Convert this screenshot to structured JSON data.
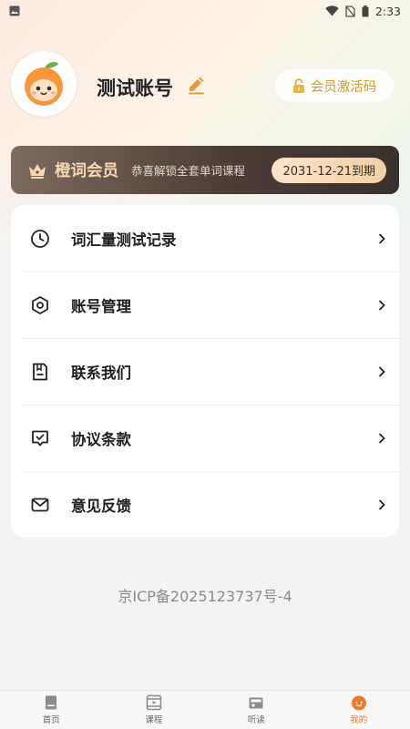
{
  "status_bar": {
    "time": "2:33"
  },
  "profile": {
    "username": "测试账号",
    "activate_label": "会员激活码"
  },
  "vip": {
    "title": "橙词会员",
    "description": "恭喜解锁全套单词课程",
    "expiry": "2031-12-21到期"
  },
  "menu": {
    "items": [
      {
        "label": "词汇量测试记录",
        "icon": "clock-icon"
      },
      {
        "label": "账号管理",
        "icon": "hexagon-settings-icon"
      },
      {
        "label": "联系我们",
        "icon": "document-icon"
      },
      {
        "label": "协议条款",
        "icon": "chat-check-icon"
      },
      {
        "label": "意见反馈",
        "icon": "mail-icon"
      }
    ]
  },
  "footer": {
    "icp": "京ICP备2025123737号-4"
  },
  "tabs": [
    {
      "label": "首页",
      "icon": "book-icon",
      "active": false
    },
    {
      "label": "课程",
      "icon": "video-icon",
      "active": false
    },
    {
      "label": "听读",
      "icon": "radio-icon",
      "active": false
    },
    {
      "label": "我的",
      "icon": "orange-face-icon",
      "active": true
    }
  ],
  "colors": {
    "accent": "#e8782a",
    "vip_gold": "#f7d7b4",
    "activate": "#d8962e"
  }
}
